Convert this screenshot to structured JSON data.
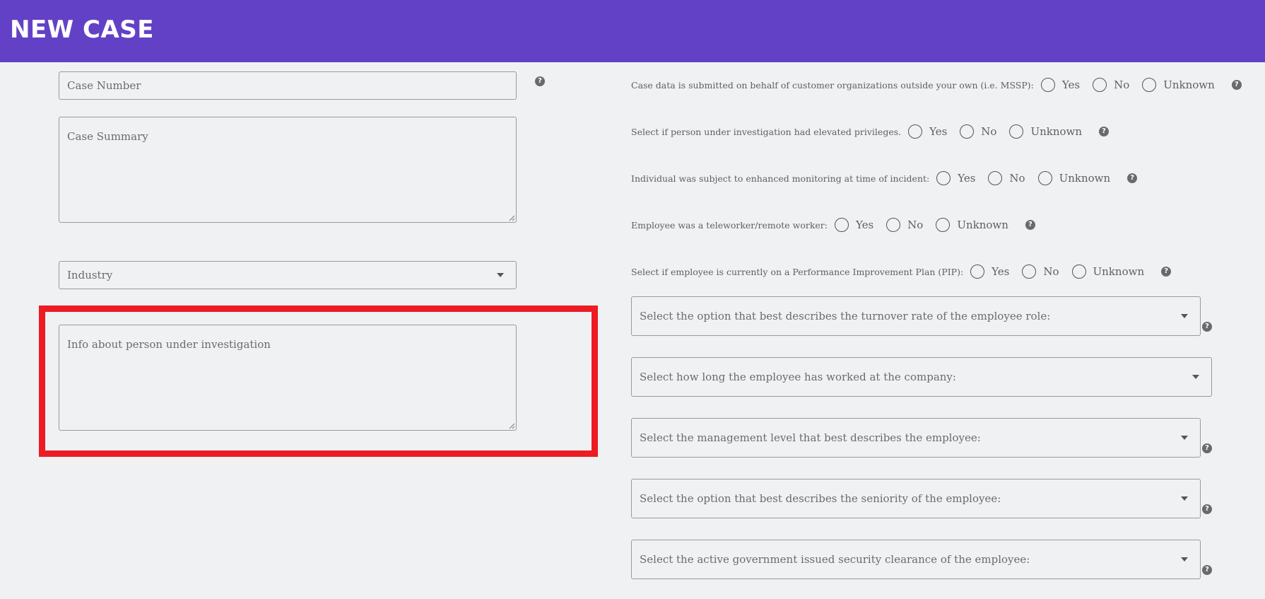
{
  "header": {
    "title": "NEW CASE"
  },
  "left": {
    "case_number": {
      "placeholder": "Case Number"
    },
    "case_summary": {
      "placeholder": "Case Summary"
    },
    "industry": {
      "placeholder": "Industry"
    },
    "person_info": {
      "placeholder": "Info about person under investigation"
    }
  },
  "right": {
    "radio_questions": [
      {
        "question": "Case data is submitted on behalf of customer organizations outside your own (i.e. MSSP):",
        "options": [
          "Yes",
          "No",
          "Unknown"
        ]
      },
      {
        "question": "Select if person under investigation had elevated privileges.",
        "options": [
          "Yes",
          "No",
          "Unknown"
        ]
      },
      {
        "question": "Individual was subject to enhanced monitoring at time of incident:",
        "options": [
          "Yes",
          "No",
          "Unknown"
        ]
      },
      {
        "question": "Employee was a teleworker/remote worker:",
        "options": [
          "Yes",
          "No",
          "Unknown"
        ]
      },
      {
        "question": "Select if employee is currently on a Performance Improvement Plan (PIP):",
        "options": [
          "Yes",
          "No",
          "Unknown"
        ]
      }
    ],
    "selects": [
      {
        "placeholder": "Select the option that best describes the turnover rate of the employee role:"
      },
      {
        "placeholder": "Select how long the employee has worked at the company:"
      },
      {
        "placeholder": "Select the management level that best describes the employee:"
      },
      {
        "placeholder": "Select the option that best describes the seniority of the employee:"
      },
      {
        "placeholder": "Select the active government issued security clearance of the employee:"
      }
    ]
  },
  "help_glyph": "?",
  "colors": {
    "header": "#6341c6",
    "highlight": "#ec1c24",
    "background": "#f0f1f3"
  }
}
